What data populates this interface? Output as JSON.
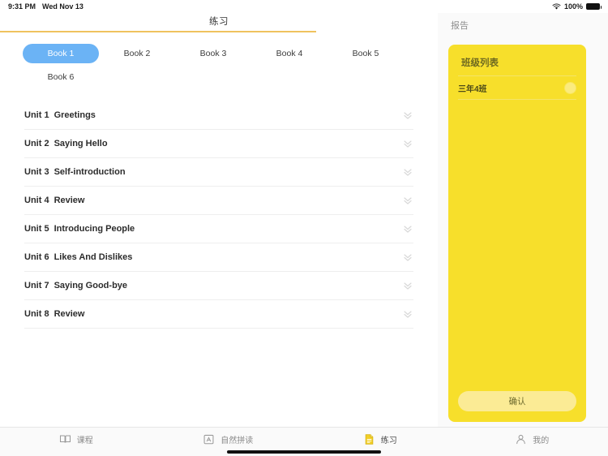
{
  "status_bar": {
    "time": "9:31 PM",
    "date": "Wed Nov 13",
    "battery_percent": "100%",
    "wifi_icon": "wifi-icon",
    "battery_icon": "battery-full-icon"
  },
  "left_pane": {
    "title": "练习",
    "accent_color": "#efc25e",
    "book_tabs": [
      {
        "label": "Book 1",
        "active": true
      },
      {
        "label": "Book 2",
        "active": false
      },
      {
        "label": "Book 3",
        "active": false
      },
      {
        "label": "Book 4",
        "active": false
      },
      {
        "label": "Book 5",
        "active": false
      },
      {
        "label": "Book 6",
        "active": false
      }
    ],
    "active_tab_color": "#6bb3f5",
    "units": [
      {
        "no": "Unit 1",
        "name": "Greetings",
        "expand_icon": "double-chevron-down-icon"
      },
      {
        "no": "Unit 2",
        "name": "Saying Hello",
        "expand_icon": "double-chevron-down-icon"
      },
      {
        "no": "Unit 3",
        "name": "Self-introduction",
        "expand_icon": "double-chevron-down-icon"
      },
      {
        "no": "Unit 4",
        "name": "Review",
        "expand_icon": "double-chevron-down-icon"
      },
      {
        "no": "Unit 5",
        "name": "Introducing People",
        "expand_icon": "double-chevron-down-icon"
      },
      {
        "no": "Unit 6",
        "name": "Likes And Dislikes",
        "expand_icon": "double-chevron-down-icon"
      },
      {
        "no": "Unit 7",
        "name": "Saying Good-bye",
        "expand_icon": "double-chevron-down-icon"
      },
      {
        "no": "Unit 8",
        "name": "Review",
        "expand_icon": "double-chevron-down-icon"
      }
    ]
  },
  "right_pane": {
    "report_label": "报告",
    "card": {
      "title": "班级列表",
      "background_color": "#f7df2b",
      "items": [
        {
          "name": "三年4班",
          "selected": false
        }
      ],
      "confirm_label": "确认"
    }
  },
  "tab_bar": {
    "items": [
      {
        "label": "课程",
        "icon": "book-open-icon",
        "active": false
      },
      {
        "label": "自然拼读",
        "icon": "phonics-card-icon",
        "active": false
      },
      {
        "label": "练习",
        "icon": "document-icon",
        "active": true
      },
      {
        "label": "我的",
        "icon": "person-icon",
        "active": false
      }
    ],
    "active_color": "#e8c52a"
  }
}
